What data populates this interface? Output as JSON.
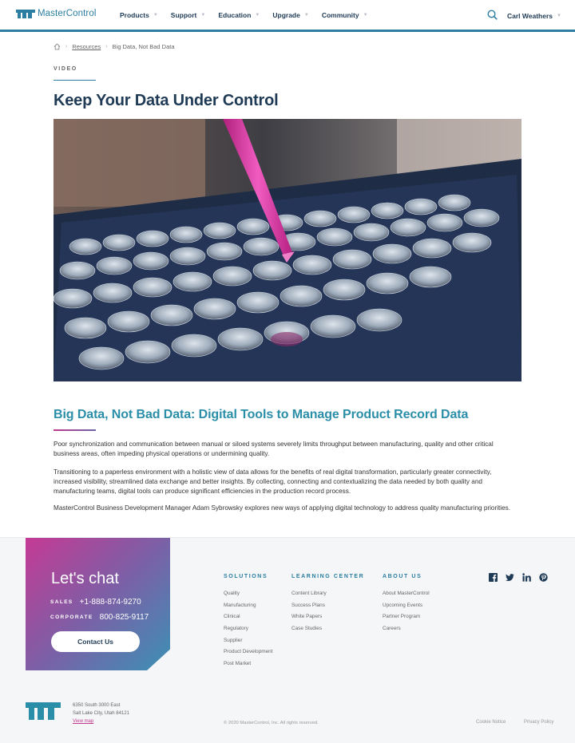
{
  "header": {
    "brand": "MasterControl",
    "nav": [
      {
        "label": "Products"
      },
      {
        "label": "Support"
      },
      {
        "label": "Education"
      },
      {
        "label": "Upgrade"
      },
      {
        "label": "Community"
      }
    ],
    "user": "Carl Weathers",
    "icons": {
      "search": "search-icon",
      "caret": "chevron-down-icon"
    },
    "colors": {
      "brand": "#2b7ea1",
      "navy": "#1e3a55",
      "accent": "#2b8ea8",
      "magenta": "#c0398c"
    }
  },
  "breadcrumb": {
    "items": [
      "Resources",
      "Big Data, Not Bad Data"
    ]
  },
  "main": {
    "eyebrow": "VIDEO",
    "title": "Keep Your Data Under Control",
    "section_title": "Big Data, Not Bad Data: Digital Tools to Manage Product Record Data",
    "paragraphs": [
      "Poor synchronization and communication between manual or siloed systems severely limits throughput between manufacturing, quality and other critical business areas, often impeding physical operations or undermining quality.",
      "Transitioning to a paperless environment with a holistic view of data allows for the benefits of real digital transformation, particularly greater connectivity, increased visibility, streamlined data exchange and better insights. By collecting, connecting and contextualizing the data needed by both quality and manufacturing teams, digital tools can produce significant efficiencies in the production record process.",
      "MasterControl Business Development Manager Adam Sybrowsky explores new ways of applying digital technology to address quality manufacturing priorities."
    ]
  },
  "footer": {
    "chat": {
      "title": "Let's chat",
      "sales_label": "SALES",
      "sales_phone": "+1-888-874-9270",
      "corporate_label": "CORPORATE",
      "corporate_phone": "800-825-9117",
      "button": "Contact Us"
    },
    "columns": [
      {
        "title": "SOLUTIONS",
        "links": [
          "Quality",
          "Manufacturing",
          "Clinical",
          "Regulatory",
          "Supplier",
          "Product Development",
          "Post Market"
        ]
      },
      {
        "title": "LEARNING CENTER",
        "links": [
          "Content Library",
          "Success Plans",
          "White Papers",
          "Case Studies"
        ]
      },
      {
        "title": "ABOUT US",
        "links": [
          "About MasterControl",
          "Upcoming Events",
          "Partner Program",
          "Careers"
        ]
      }
    ],
    "social": [
      "facebook-icon",
      "twitter-icon",
      "linkedin-icon",
      "pinterest-icon"
    ],
    "address": [
      "6350 South 3000 East",
      "Salt Lake City, Utah 84121"
    ],
    "view_map": "View map",
    "copyright": "© 2020 MasterControl, Inc. All rights reserved.",
    "legal": [
      "Cookie Notice",
      "Privacy Policy"
    ]
  }
}
